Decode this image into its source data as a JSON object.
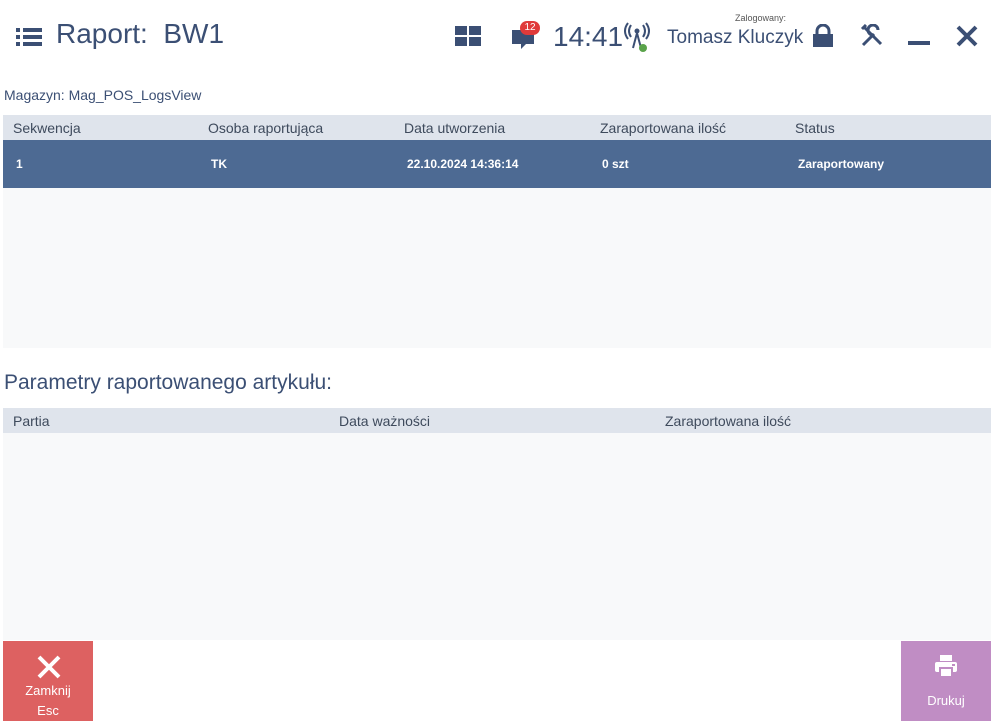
{
  "header": {
    "title": "Raport:  BW1",
    "notifications_count": "12",
    "clock": "14:41",
    "logged_in_label": "Zalogowany:",
    "user_name": "Tomasz Kluczyk",
    "icons": [
      "menu-icon",
      "tiles-icon",
      "chat-icon",
      "signal-icon",
      "lock-icon",
      "tools-icon",
      "minimize-icon",
      "close-icon"
    ]
  },
  "warehouse_label": "Magazyn: Mag_POS_LogsView",
  "reports_grid": {
    "columns": [
      "Sekwencja",
      "Osoba raportująca",
      "Data utworzenia",
      "Zaraportowana ilość",
      "Status"
    ],
    "rows": [
      [
        "1",
        "TK",
        "22.10.2024 14:36:14",
        "0 szt",
        "Zaraportowany"
      ]
    ]
  },
  "params_title": "Parametry raportowanego artykułu:",
  "params_grid": {
    "columns": [
      "Partia",
      "Data ważności",
      "Zaraportowana ilość"
    ],
    "rows": []
  },
  "buttons": {
    "close_label": "Zamknij",
    "close_shortcut": "Esc",
    "print_label": "Drukuj"
  },
  "colors": {
    "accent": "#3b4f74",
    "selected_row": "#4d6a93",
    "close_button": "#dd6161",
    "print_button": "#c08dc4",
    "badge": "#e03a3a"
  }
}
